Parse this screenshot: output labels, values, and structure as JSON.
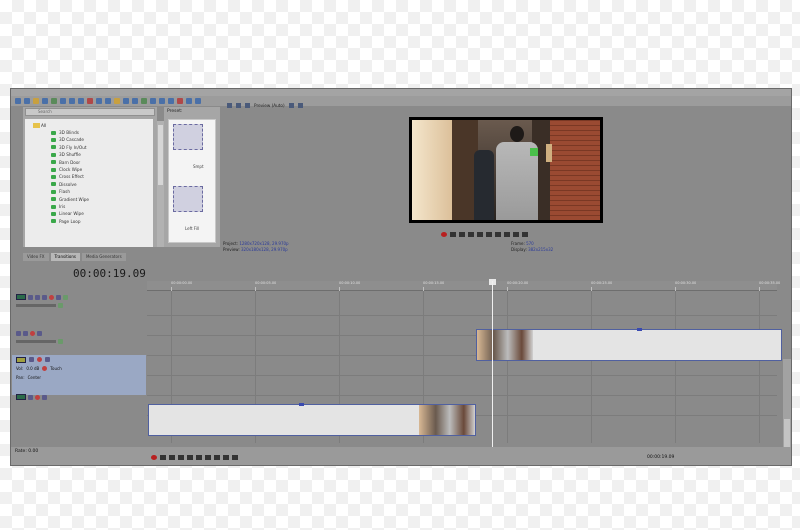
{
  "explorer": {
    "search_placeholder": "Search",
    "items": [
      "3D Blinds",
      "3D Cascade",
      "3D Fly In/Out",
      "3D Shuffle",
      "Barn Door",
      "Clock Wipe",
      "Cross Effect",
      "Dissolve",
      "Flash",
      "Gradient Wipe",
      "Iris",
      "Linear Wipe",
      "Page Loop"
    ]
  },
  "presets": {
    "label": "Preset:",
    "thumb1_label": "Smpt",
    "thumb2_label": "Left Fill"
  },
  "tabs": [
    "Video FX",
    "Transitions",
    "Media Generators"
  ],
  "preview": {
    "mode_label": "Preview (Auto)",
    "project_label": "Project:",
    "project_value": "1280x720x128, 29.970p",
    "preview_label": "Preview:",
    "preview_value": "320x180x128, 29.970p",
    "frame_label": "Frame:",
    "frame_value": "570",
    "display_label": "Display:",
    "display_value": "382x215x32"
  },
  "timeline": {
    "timecode": "00:00:19.09",
    "ruler_labels": [
      "00:00:00.00",
      "00:00:05.00",
      "00:00:10.00",
      "00:00:15.00",
      "00:00:20.00",
      "00:00:25.00",
      "00:00:30.00",
      "00:00:35.00"
    ],
    "audio_vol": "Vol:",
    "audio_vol_value": "0.0 dB",
    "audio_touch": "Touch",
    "audio_pan": "Pan:",
    "audio_pan_value": "Center"
  },
  "status": {
    "rate": "Rate: 0.00",
    "bottom_time": "00:00:19.09"
  }
}
